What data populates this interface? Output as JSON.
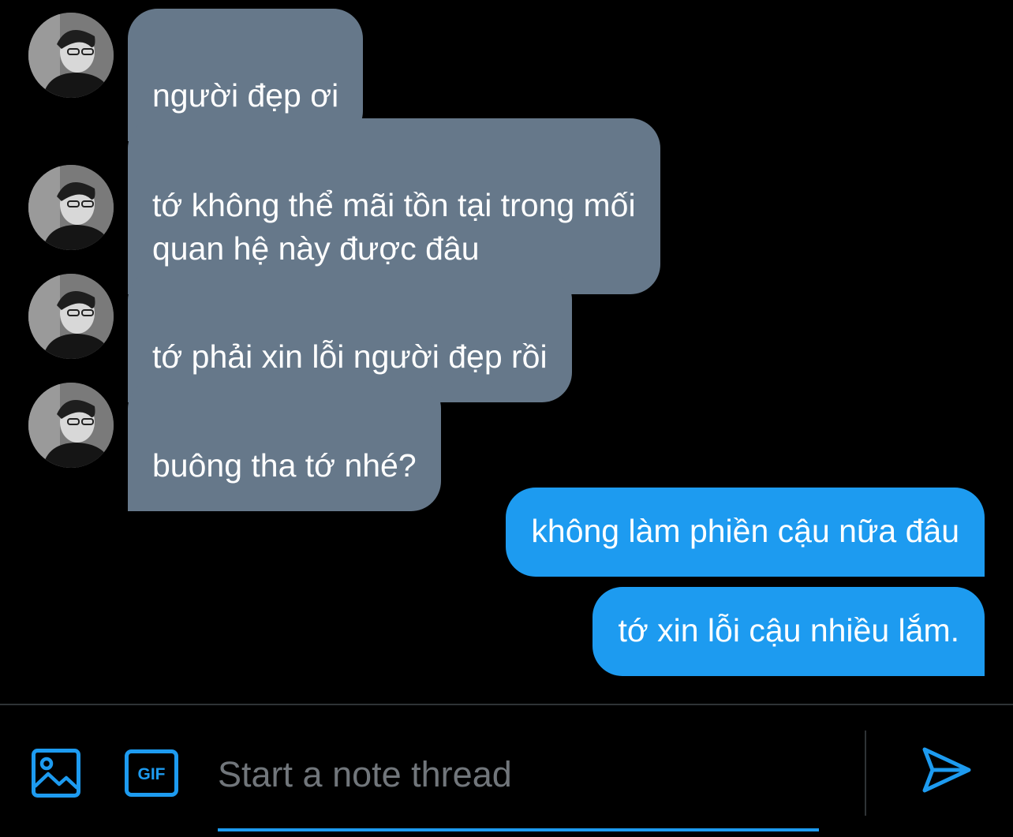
{
  "incoming": {
    "avatar_icon": "profile-photo-avatar",
    "messages": [
      {
        "text": "người đẹp ơi"
      },
      {
        "text": "tớ không thể mãi tồn tại trong mối\nquan hệ này được đâu"
      },
      {
        "text": "tớ phải xin lỗi người đẹp rồi"
      },
      {
        "text": "buông tha tớ nhé?"
      }
    ]
  },
  "outgoing": {
    "messages": [
      {
        "text": "không làm phiền cậu nữa đâu"
      },
      {
        "text": "tớ xin lỗi cậu nhiều lắm."
      }
    ]
  },
  "composer": {
    "placeholder": "Start a note thread",
    "value": "",
    "media_icon": "image-icon",
    "gif_label": "GIF",
    "send_icon": "send-icon"
  },
  "colors": {
    "background": "#000000",
    "incoming_bubble": "#66788a",
    "outgoing_bubble": "#1d9bf0",
    "accent": "#1d9bf0",
    "placeholder": "#71767b"
  }
}
